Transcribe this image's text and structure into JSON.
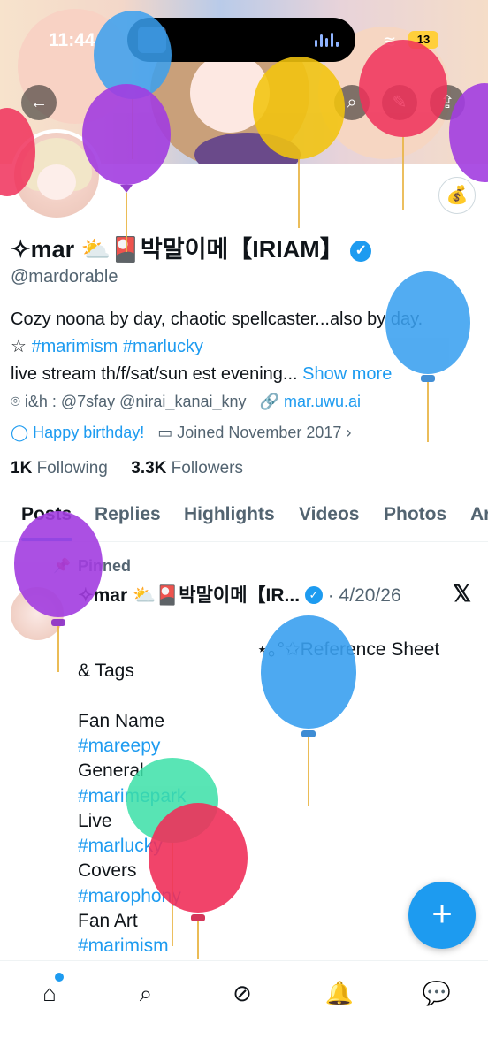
{
  "status_bar": {
    "time": "11:44",
    "battery": "13"
  },
  "profile": {
    "display_name": "✧mar ⛅🎴박말이메【IRIAM】",
    "handle": "@mardorable",
    "bio_line1": "Cozy noona by day, chaotic spellcaster...also by day.",
    "bio_star": "☆ ",
    "bio_tag1": "#marimism",
    "bio_tag2": "#marlucky",
    "bio_line3": "live stream th/f/sat/sun est evening...",
    "show_more": "Show more",
    "affiliation": "i&h : @7sfay @nirai_kanai_kny",
    "website": "mar.uwu.ai",
    "birthday": "Happy birthday!",
    "joined": "Joined November 2017",
    "following_count": "1K",
    "following_label": "Following",
    "followers_count": "3.3K",
    "followers_label": "Followers"
  },
  "tabs": [
    "Posts",
    "Replies",
    "Highlights",
    "Videos",
    "Photos",
    "Ar"
  ],
  "pinned_post": {
    "pinned_label": "Pinned",
    "author": "✧mar ⛅🎴박말이메【IR...",
    "date": "· 4/20/26",
    "line1": "⋆｡°✩Reference Sheet",
    "line2": "& Tags",
    "fan_name_label": "Fan Name",
    "fan_name_tag": "#mareepy",
    "general_label": "General",
    "general_tag": "#marimepark",
    "live_label": "Live",
    "live_tag": "#marlucky",
    "covers_label": "Covers",
    "covers_tag": "#marophony",
    "fanart_label": "Fan Art",
    "fanart_tag": "#marimism"
  },
  "fab_label": "+",
  "icons": {
    "back": "←",
    "search": "⌕",
    "share": "⇪",
    "sticker": "⚲",
    "x_logo": "𝕏",
    "home": "⌂",
    "explore": "⌕",
    "grok": "⊘",
    "notifications": "🔔",
    "messages": "💬"
  },
  "colors": {
    "accent": "#1d9bf0",
    "text": "#0f1419",
    "muted": "#536471"
  }
}
